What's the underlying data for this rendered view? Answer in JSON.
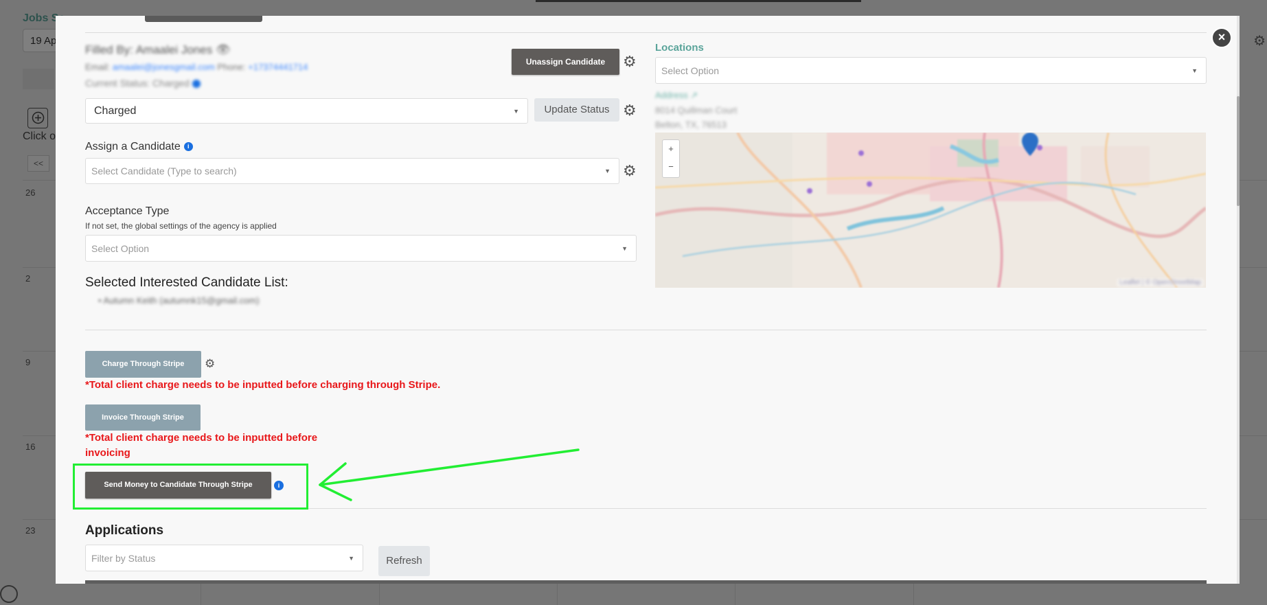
{
  "background": {
    "title": "Jobs Sc",
    "date_value": "19 Ap",
    "click_hint": "Click o",
    "nav_prev": "<<",
    "day_numbers": [
      "26",
      "2",
      "9",
      "16",
      "23"
    ]
  },
  "modal": {
    "close_label": "×",
    "filled_by": "Filled By: Amaalei Jones",
    "email_label": "Email:",
    "email_value": "amaalei@jonesgmail.com",
    "phone_label": "Phone:",
    "phone_value": "+17374441714",
    "current_status": "Current Status: Charged",
    "unassign_button": "Unassign Candidate",
    "status_select_value": "Charged",
    "update_status_button": "Update Status",
    "assign_label": "Assign a Candidate",
    "assign_placeholder": "Select Candidate (Type to search)",
    "acceptance_label": "Acceptance Type",
    "acceptance_sub": "If not set, the global settings of the agency is applied",
    "acceptance_placeholder": "Select Option",
    "interested_heading": "Selected Interested Candidate List:",
    "interested_item": "Autumn Keith (autumnk15@gmail.com)",
    "charge_button": "Charge Through Stripe",
    "charge_warning": "*Total client charge needs to be inputted before charging through Stripe.",
    "invoice_button": "Invoice Through Stripe",
    "invoice_warning": "*Total client charge needs to be inputted before invoicing",
    "send_money_button": "Send Money to Candidate Through Stripe",
    "applications_heading": "Applications",
    "filter_placeholder": "Filter by Status",
    "refresh_button": "Refresh",
    "locations_label": "Locations",
    "locations_placeholder": "Select Option",
    "address_label": "Address ↗",
    "address_line1": "8014 Quillman Court",
    "address_line2": "Belton, TX, 76513",
    "map_attribution": "Leaflet | © OpenStreetMap"
  },
  "colors": {
    "accent_green": "#5aa49a",
    "highlight_green": "#22ee33",
    "warning_red": "#e8171a",
    "info_blue": "#1a6fe0"
  }
}
